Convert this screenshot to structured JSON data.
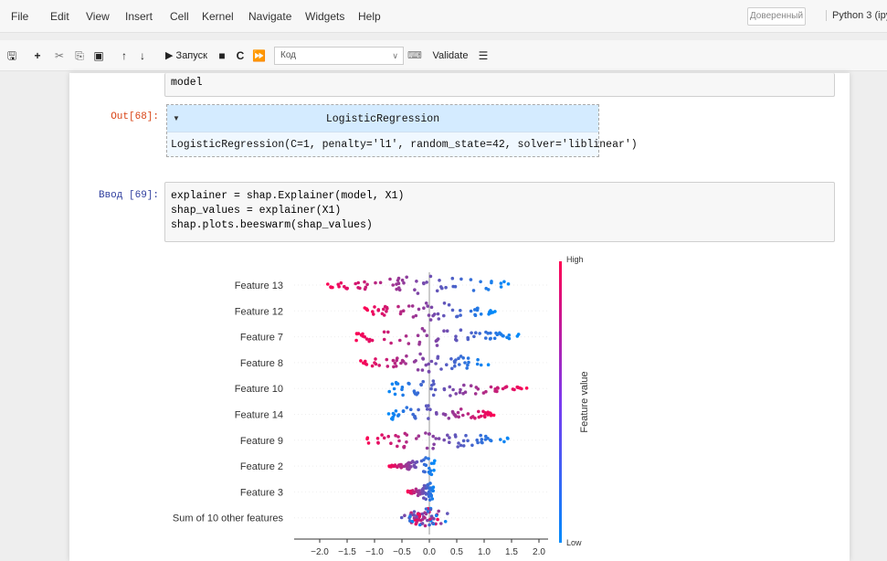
{
  "menubar": {
    "items": [
      "File",
      "Edit",
      "View",
      "Insert",
      "Cell",
      "Kernel",
      "Navigate",
      "Widgets",
      "Help"
    ],
    "trusted": "Доверенный",
    "kernel": "Python 3 (ipy"
  },
  "toolbar": {
    "run_label": "▶ Запуск",
    "cell_type": "Код",
    "validate_label": "Validate"
  },
  "cells": {
    "prev_input_tail": "model",
    "out68_prompt": "Out[68]:",
    "lr_title": "LogisticRegression",
    "lr_params": "LogisticRegression(C=1, penalty='l1', random_state=42, solver='liblinear')",
    "in69_prompt": "Ввод [69]:",
    "code": [
      "explainer = shap.Explainer(model, X1)",
      "shap_values = explainer(X1)",
      "shap.plots.beeswarm(shap_values)"
    ]
  },
  "colors": {
    "low": "#008bfb",
    "high": "#ff0052",
    "accent": "#303f9f",
    "out": "#d84315"
  },
  "chart_data": {
    "type": "scatter",
    "title": "",
    "xlabel": "",
    "xlim": [
      -2.1,
      2.1
    ],
    "x_ticks": [
      "−2.0",
      "−1.5",
      "−1.0",
      "−0.5",
      "0.0",
      "0.5",
      "1.0",
      "1.5",
      "2.0"
    ],
    "x_tick_values": [
      -2.0,
      -1.5,
      -1.0,
      -0.5,
      0.0,
      0.5,
      1.0,
      1.5,
      2.0
    ],
    "colorbar": {
      "title": "Feature value",
      "high": "High",
      "low": "Low"
    },
    "features": [
      {
        "name": "Feature 13",
        "min": -1.9,
        "max": 1.45,
        "low_side": "right"
      },
      {
        "name": "Feature 12",
        "min": -1.2,
        "max": 1.2,
        "low_side": "right"
      },
      {
        "name": "Feature 7",
        "min": -1.4,
        "max": 1.65,
        "low_side": "right"
      },
      {
        "name": "Feature 8",
        "min": -1.3,
        "max": 1.1,
        "low_side": "right"
      },
      {
        "name": "Feature 10",
        "min": -0.8,
        "max": 1.8,
        "low_side": "left"
      },
      {
        "name": "Feature 14",
        "min": -0.75,
        "max": 1.2,
        "low_side": "left"
      },
      {
        "name": "Feature 9",
        "min": -1.2,
        "max": 1.5,
        "low_side": "right"
      },
      {
        "name": "Feature 2",
        "min": -0.75,
        "max": 0.1,
        "low_side": "right"
      },
      {
        "name": "Feature 3",
        "min": -0.4,
        "max": 0.1,
        "low_side": "right"
      },
      {
        "name": "Sum of 10 other features",
        "min": -0.65,
        "max": 0.45,
        "low_side": "mixed"
      }
    ]
  }
}
